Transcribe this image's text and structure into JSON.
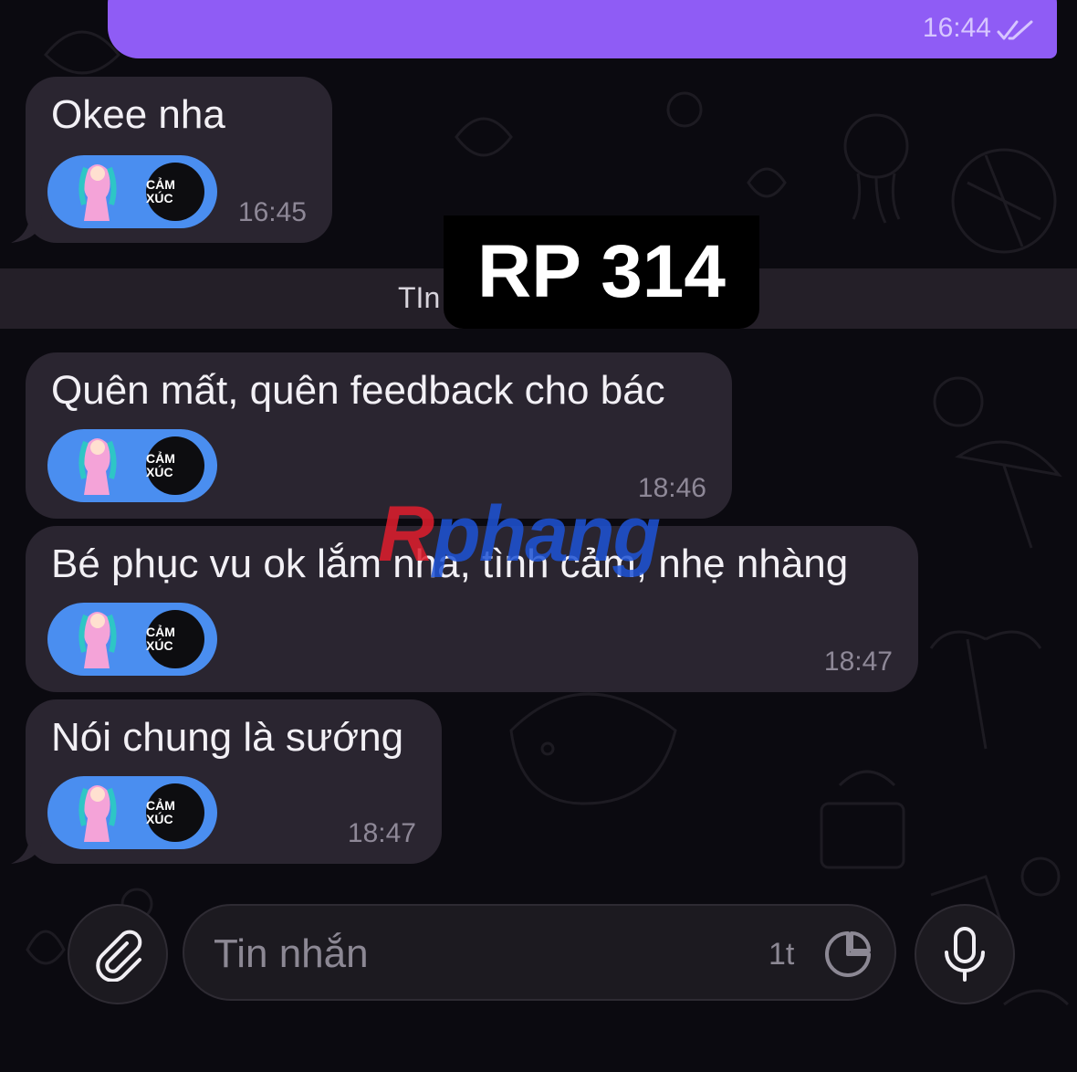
{
  "messages": [
    {
      "direction": "outgoing",
      "text": "",
      "time": "16:44",
      "read": true
    },
    {
      "direction": "incoming",
      "text": "Okee nha",
      "time": "16:45",
      "reaction": "CẢM XÚC"
    },
    {
      "direction": "incoming",
      "text": "Quên mất, quên feedback cho bác",
      "time": "18:46",
      "reaction": "CẢM XÚC"
    },
    {
      "direction": "incoming",
      "text": "Bé phục vu ok lắm nha, tình cảm, nhẹ nhàng",
      "time": "18:47",
      "reaction": "CẢM XÚC"
    },
    {
      "direction": "incoming",
      "text": "Nói chung là sướng",
      "time": "18:47",
      "reaction": "CẢM XÚC"
    }
  ],
  "unread_divider": {
    "label": "TIn"
  },
  "overlay_badge": {
    "text": "RP 314"
  },
  "watermark": {
    "first": "R",
    "rest": "phang"
  },
  "composer": {
    "placeholder": "Tin nhắn",
    "counter": "1t",
    "attach_icon": "paperclip-icon",
    "sticker_icon": "sticker-icon",
    "mic_icon": "microphone-icon"
  },
  "colors": {
    "outgoing_bubble": "#8f5cf5",
    "incoming_bubble": "#2a2530",
    "reaction_pill": "#4a8ef0",
    "background": "#0b0a10"
  }
}
